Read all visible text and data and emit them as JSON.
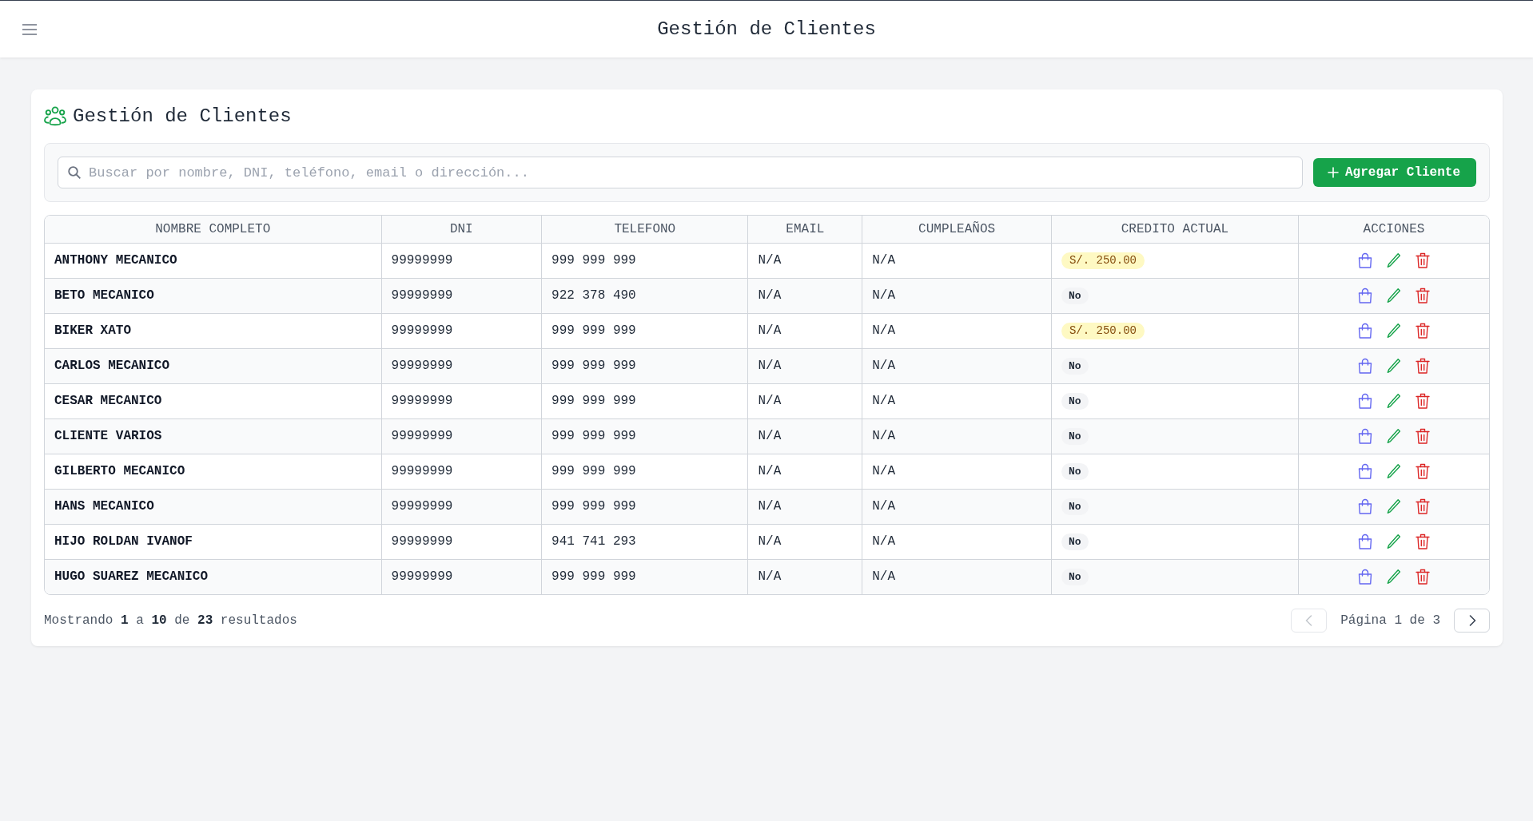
{
  "header": {
    "title": "Gestión de Clientes"
  },
  "card": {
    "title": "Gestión de Clientes"
  },
  "search": {
    "placeholder": "Buscar por nombre, DNI, teléfono, email o dirección..."
  },
  "add_button": {
    "label": "Agregar Cliente"
  },
  "table": {
    "columns": [
      "NOMBRE COMPLETO",
      "DNI",
      "TELEFONO",
      "EMAIL",
      "CUMPLEAÑOS",
      "CREDITO ACTUAL",
      "ACCIONES"
    ],
    "rows": [
      {
        "name": "ANTHONY MECANICO",
        "dni": "99999999",
        "phone": "999 999 999",
        "email": "N/A",
        "birthday": "N/A",
        "credit": {
          "kind": "amount",
          "text": "S/. 250.00"
        }
      },
      {
        "name": "BETO MECANICO",
        "dni": "99999999",
        "phone": "922 378 490",
        "email": "N/A",
        "birthday": "N/A",
        "credit": {
          "kind": "none",
          "text": "No"
        }
      },
      {
        "name": "BIKER XATO",
        "dni": "99999999",
        "phone": "999 999 999",
        "email": "N/A",
        "birthday": "N/A",
        "credit": {
          "kind": "amount",
          "text": "S/. 250.00"
        }
      },
      {
        "name": "CARLOS MECANICO",
        "dni": "99999999",
        "phone": "999 999 999",
        "email": "N/A",
        "birthday": "N/A",
        "credit": {
          "kind": "none",
          "text": "No"
        }
      },
      {
        "name": "CESAR MECANICO",
        "dni": "99999999",
        "phone": "999 999 999",
        "email": "N/A",
        "birthday": "N/A",
        "credit": {
          "kind": "none",
          "text": "No"
        }
      },
      {
        "name": "CLIENTE VARIOS",
        "dni": "99999999",
        "phone": "999 999 999",
        "email": "N/A",
        "birthday": "N/A",
        "credit": {
          "kind": "none",
          "text": "No"
        }
      },
      {
        "name": "GILBERTO MECANICO",
        "dni": "99999999",
        "phone": "999 999 999",
        "email": "N/A",
        "birthday": "N/A",
        "credit": {
          "kind": "none",
          "text": "No"
        }
      },
      {
        "name": "HANS MECANICO",
        "dni": "99999999",
        "phone": "999 999 999",
        "email": "N/A",
        "birthday": "N/A",
        "credit": {
          "kind": "none",
          "text": "No"
        }
      },
      {
        "name": "HIJO ROLDAN IVANOF",
        "dni": "99999999",
        "phone": "941 741 293",
        "email": "N/A",
        "birthday": "N/A",
        "credit": {
          "kind": "none",
          "text": "No"
        }
      },
      {
        "name": "HUGO SUAREZ MECANICO",
        "dni": "99999999",
        "phone": "999 999 999",
        "email": "N/A",
        "birthday": "N/A",
        "credit": {
          "kind": "none",
          "text": "No"
        }
      }
    ]
  },
  "footer": {
    "summary": "Mostrando **1** a **10** de **23** resultados",
    "pagination": {
      "previous": {
        "disabled": true
      },
      "label": "Página 1 de 3",
      "next": {
        "disabled": false
      }
    }
  }
}
